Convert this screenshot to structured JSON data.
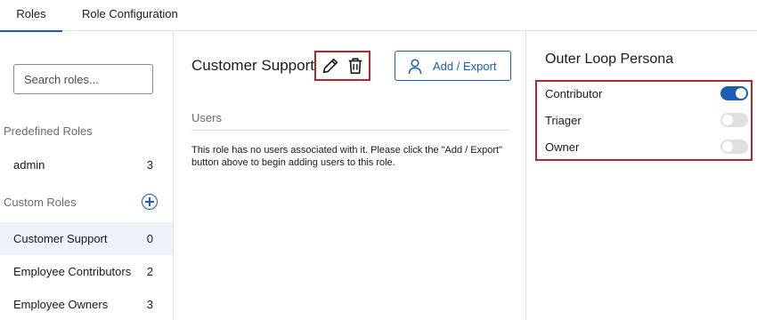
{
  "tabs": [
    {
      "label": "Roles",
      "active": true
    },
    {
      "label": "Role Configuration",
      "active": false
    }
  ],
  "sidebar": {
    "search_placeholder": "Search roles...",
    "predefined_header": "Predefined Roles",
    "predefined_roles": [
      {
        "name": "admin",
        "count": "3"
      }
    ],
    "custom_header": "Custom Roles",
    "custom_roles": [
      {
        "name": "Customer Support",
        "count": "0",
        "selected": true
      },
      {
        "name": "Employee Contributors",
        "count": "2",
        "selected": false
      },
      {
        "name": "Employee Owners",
        "count": "3",
        "selected": false
      }
    ]
  },
  "role": {
    "title": "Customer Support",
    "add_export_label": "Add / Export",
    "users_header": "Users",
    "empty_message": "This role has no users associated with it. Please click the \"Add / Export\" button above to begin adding users to this role."
  },
  "persona": {
    "title": "Outer Loop Persona",
    "options": [
      {
        "label": "Contributor",
        "enabled": true
      },
      {
        "label": "Triager",
        "enabled": false
      },
      {
        "label": "Owner",
        "enabled": false
      }
    ]
  },
  "colors": {
    "accent": "#1a5fb4",
    "highlight": "#b3262e",
    "selected_bg": "#eef2f8"
  },
  "icons": [
    "pencil-icon",
    "trash-icon",
    "person-icon",
    "add-circle-icon"
  ]
}
